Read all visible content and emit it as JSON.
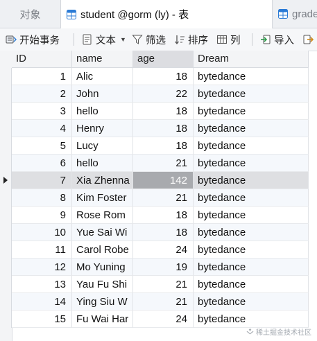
{
  "tabs": {
    "objects_label": "对象",
    "table_label": "student @gorm (ly) - 表",
    "grade_label": "grade"
  },
  "toolbar": {
    "begin_transaction": "开始事务",
    "text": "文本",
    "filter": "筛选",
    "sort": "排序",
    "columns": "列",
    "import": "导入"
  },
  "grid": {
    "columns": [
      "ID",
      "name",
      "age",
      "Dream"
    ],
    "rows": [
      {
        "id": "1",
        "name": "Alic",
        "age": "18",
        "dream": "bytedance"
      },
      {
        "id": "2",
        "name": "John",
        "age": "22",
        "dream": "bytedance"
      },
      {
        "id": "3",
        "name": "hello",
        "age": "18",
        "dream": "bytedance"
      },
      {
        "id": "4",
        "name": "Henry",
        "age": "18",
        "dream": "bytedance"
      },
      {
        "id": "5",
        "name": "Lucy",
        "age": "18",
        "dream": "bytedance"
      },
      {
        "id": "6",
        "name": "hello",
        "age": "21",
        "dream": "bytedance"
      },
      {
        "id": "7",
        "name": "Xia Zhenna",
        "age": "142",
        "dream": "bytedance"
      },
      {
        "id": "8",
        "name": "Kim Foster",
        "age": "21",
        "dream": "bytedance"
      },
      {
        "id": "9",
        "name": "Rose Rom",
        "age": "18",
        "dream": "bytedance"
      },
      {
        "id": "10",
        "name": "Yue Sai Wi",
        "age": "18",
        "dream": "bytedance"
      },
      {
        "id": "11",
        "name": "Carol Robe",
        "age": "24",
        "dream": "bytedance"
      },
      {
        "id": "12",
        "name": "Mo Yuning",
        "age": "19",
        "dream": "bytedance"
      },
      {
        "id": "13",
        "name": "Yau Fu Shi",
        "age": "21",
        "dream": "bytedance"
      },
      {
        "id": "14",
        "name": "Ying Siu W",
        "age": "21",
        "dream": "bytedance"
      },
      {
        "id": "15",
        "name": "Fu Wai Har",
        "age": "24",
        "dream": "bytedance"
      }
    ]
  },
  "watermark": "稀土掘金技术社区",
  "colors": {
    "selected_row": "#dedfe2",
    "selected_cell": "#a8aaae",
    "alt_row": "#f5f8fc",
    "tab_bar": "#eef0f3"
  }
}
